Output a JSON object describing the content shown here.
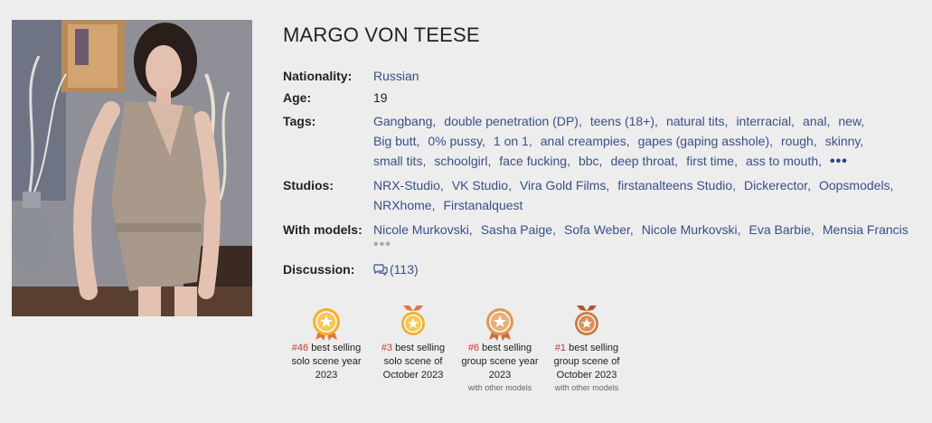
{
  "profile": {
    "name": "MARGO VON TEESE",
    "labels": {
      "nationality": "Nationality:",
      "age": "Age:",
      "tags": "Tags:",
      "studios": "Studios:",
      "models": "With models:",
      "discussion": "Discussion:"
    },
    "nationality": "Russian",
    "age": "19",
    "tags": [
      "Gangbang,",
      "double penetration (DP),",
      "teens (18+),",
      "natural tits,",
      "interracial,",
      "anal,",
      "new,",
      "Big butt,",
      "0% pussy,",
      "1 on 1,",
      "anal creampies,",
      "gapes (gaping asshole),",
      "rough,",
      "skinny,",
      "small tits,",
      "schoolgirl,",
      "face fucking,",
      "bbc,",
      "deep throat,",
      "first time,",
      "ass to mouth,"
    ],
    "tags_more": "•••",
    "studios": [
      "NRX-Studio,",
      "VK Studio,",
      "Vira Gold Films,",
      "firstanalteens Studio,",
      "Dickerector,",
      "Oopsmodels,",
      "NRXhome,",
      "Firstanalquest"
    ],
    "models": [
      "Nicole Murkovski,",
      "Sasha Paige,",
      "Sofa Weber,",
      "Nicole Murkovski,",
      "Eva Barbie,",
      "Mensia Francis"
    ],
    "models_more": "•••",
    "discussion_count": "(113)"
  },
  "awards": [
    {
      "rank": "#46",
      "line1": "best selling",
      "line2": "solo scene year",
      "line3": "2023",
      "sub": "",
      "medal": "gold-medal-icon",
      "color": "#f2b233"
    },
    {
      "rank": "#3",
      "line1": "best selling",
      "line2": "solo scene of",
      "line3": "October 2023",
      "sub": "",
      "medal": "gold-medal-icon",
      "color": "#f2b233"
    },
    {
      "rank": "#6",
      "line1": "best selling",
      "line2": "group scene year",
      "line3": "2023",
      "sub": "with other models",
      "medal": "bronze-medal-icon",
      "color": "#e09a5a"
    },
    {
      "rank": "#1",
      "line1": "best selling",
      "line2": "group scene of",
      "line3": "October 2023",
      "sub": "with other models",
      "medal": "bronze-medal-icon",
      "color": "#c77b45"
    }
  ]
}
